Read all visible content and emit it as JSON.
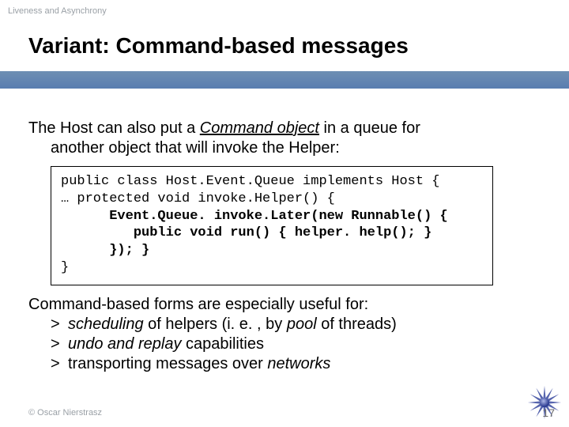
{
  "header": {
    "topic": "Liveness and Asynchrony",
    "title": "Variant: Command-based messages"
  },
  "body": {
    "intro_pre": "The Host can also put a ",
    "intro_cmd": "Command object",
    "intro_post": " in a queue for",
    "intro_line2": "another object that will invoke the Helper:",
    "code": {
      "l1": "public class Host.Event.Queue implements Host {",
      "l2": "… protected void invoke.Helper() {",
      "l3": "      Event.Queue. invoke.Later(new Runnable() {",
      "l4": "         public void run() { helper. help(); }",
      "l5": "      }); }",
      "l6": "}"
    },
    "outro": "Command-based forms are especially useful for:",
    "bullets": [
      {
        "gt": ">",
        "pre_i": "scheduling",
        "mid": " of helpers (i. e. , by ",
        "mid_i": "pool",
        "post": " of threads)"
      },
      {
        "gt": ">",
        "pre_i": "undo and replay",
        "mid": " capabilities",
        "mid_i": "",
        "post": ""
      },
      {
        "gt": ">",
        "pre_i": "",
        "mid": "transporting messages over ",
        "mid_i": "networks",
        "post": ""
      }
    ]
  },
  "footer": {
    "copyright": "© Oscar Nierstrasz",
    "page": "17"
  }
}
